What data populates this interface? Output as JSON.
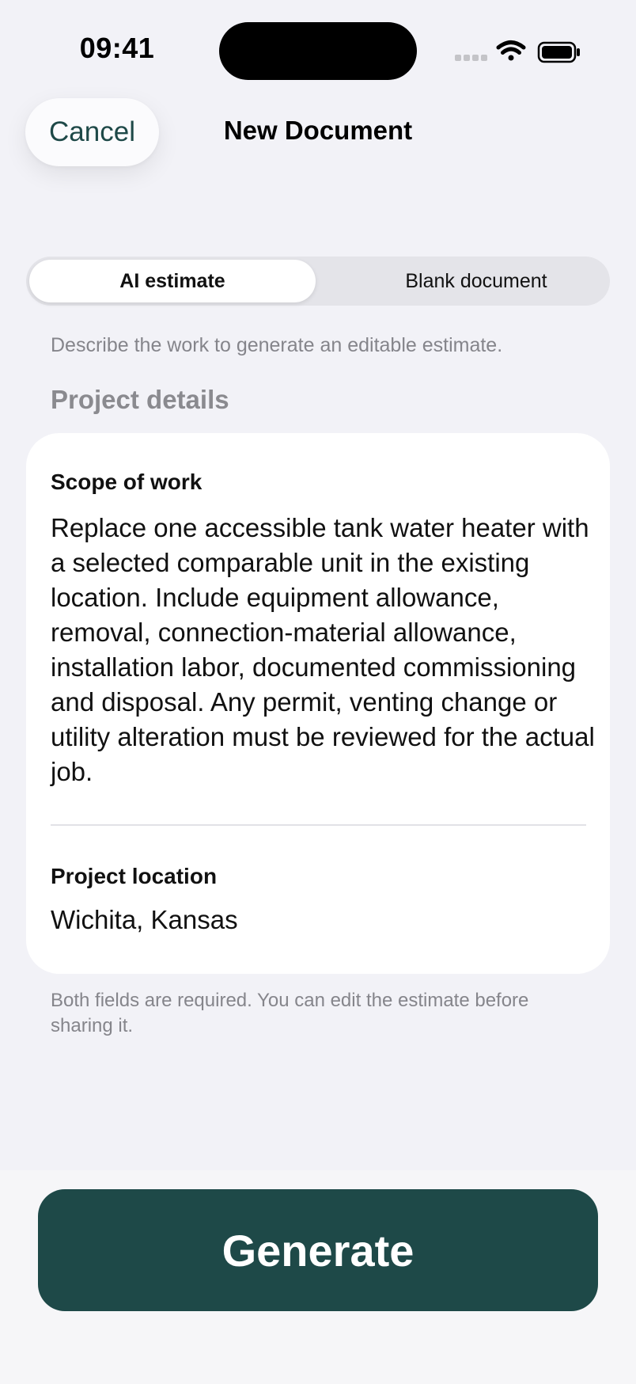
{
  "status_bar": {
    "time": "09:41",
    "icons": [
      "signal-dots-icon",
      "wifi-icon",
      "battery-icon"
    ]
  },
  "nav": {
    "cancel_label": "Cancel",
    "title": "New Document"
  },
  "segments": [
    {
      "label": "AI estimate",
      "selected": true
    },
    {
      "label": "Blank document",
      "selected": false
    }
  ],
  "hint": "Describe the work to generate an editable estimate.",
  "section_header": "Project details",
  "fields": {
    "scope": {
      "label": "Scope of work",
      "value": "Replace one accessible tank water heater with a selected comparable unit in the existing location. Include equipment allowance, removal, connection-material allowance, installation labor, documented commissioning and disposal. Any permit, venting change or utility alteration must be reviewed for the actual job."
    },
    "location": {
      "label": "Project location",
      "value": "Wichita, Kansas"
    }
  },
  "footnote": "Both fields are required. You can edit the estimate before sharing it.",
  "generate_label": "Generate",
  "colors": {
    "accent": "#1e4948",
    "background": "#f2f2f7",
    "secondary_text": "#85858b"
  }
}
